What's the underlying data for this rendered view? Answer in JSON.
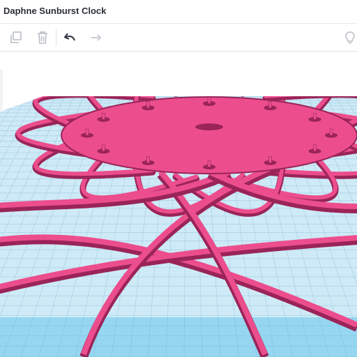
{
  "app": {
    "design_title": "Daphne Sunburst Clock"
  },
  "toolbar": {
    "items": [
      {
        "name": "copy",
        "icon": "copy-icon"
      },
      {
        "name": "delete",
        "icon": "trash-icon"
      },
      {
        "name": "undo",
        "icon": "undo-icon"
      },
      {
        "name": "redo",
        "icon": "redo-icon"
      },
      {
        "name": "light",
        "icon": "lightbulb-icon"
      }
    ]
  },
  "colors": {
    "model": "#ec4e8d",
    "model_dark": "#9a2458",
    "grid_base": "#cfeaf7",
    "grid_line": "#a6cfe3",
    "grid_edge": "#2fb1e6",
    "background": "#ffffff"
  }
}
